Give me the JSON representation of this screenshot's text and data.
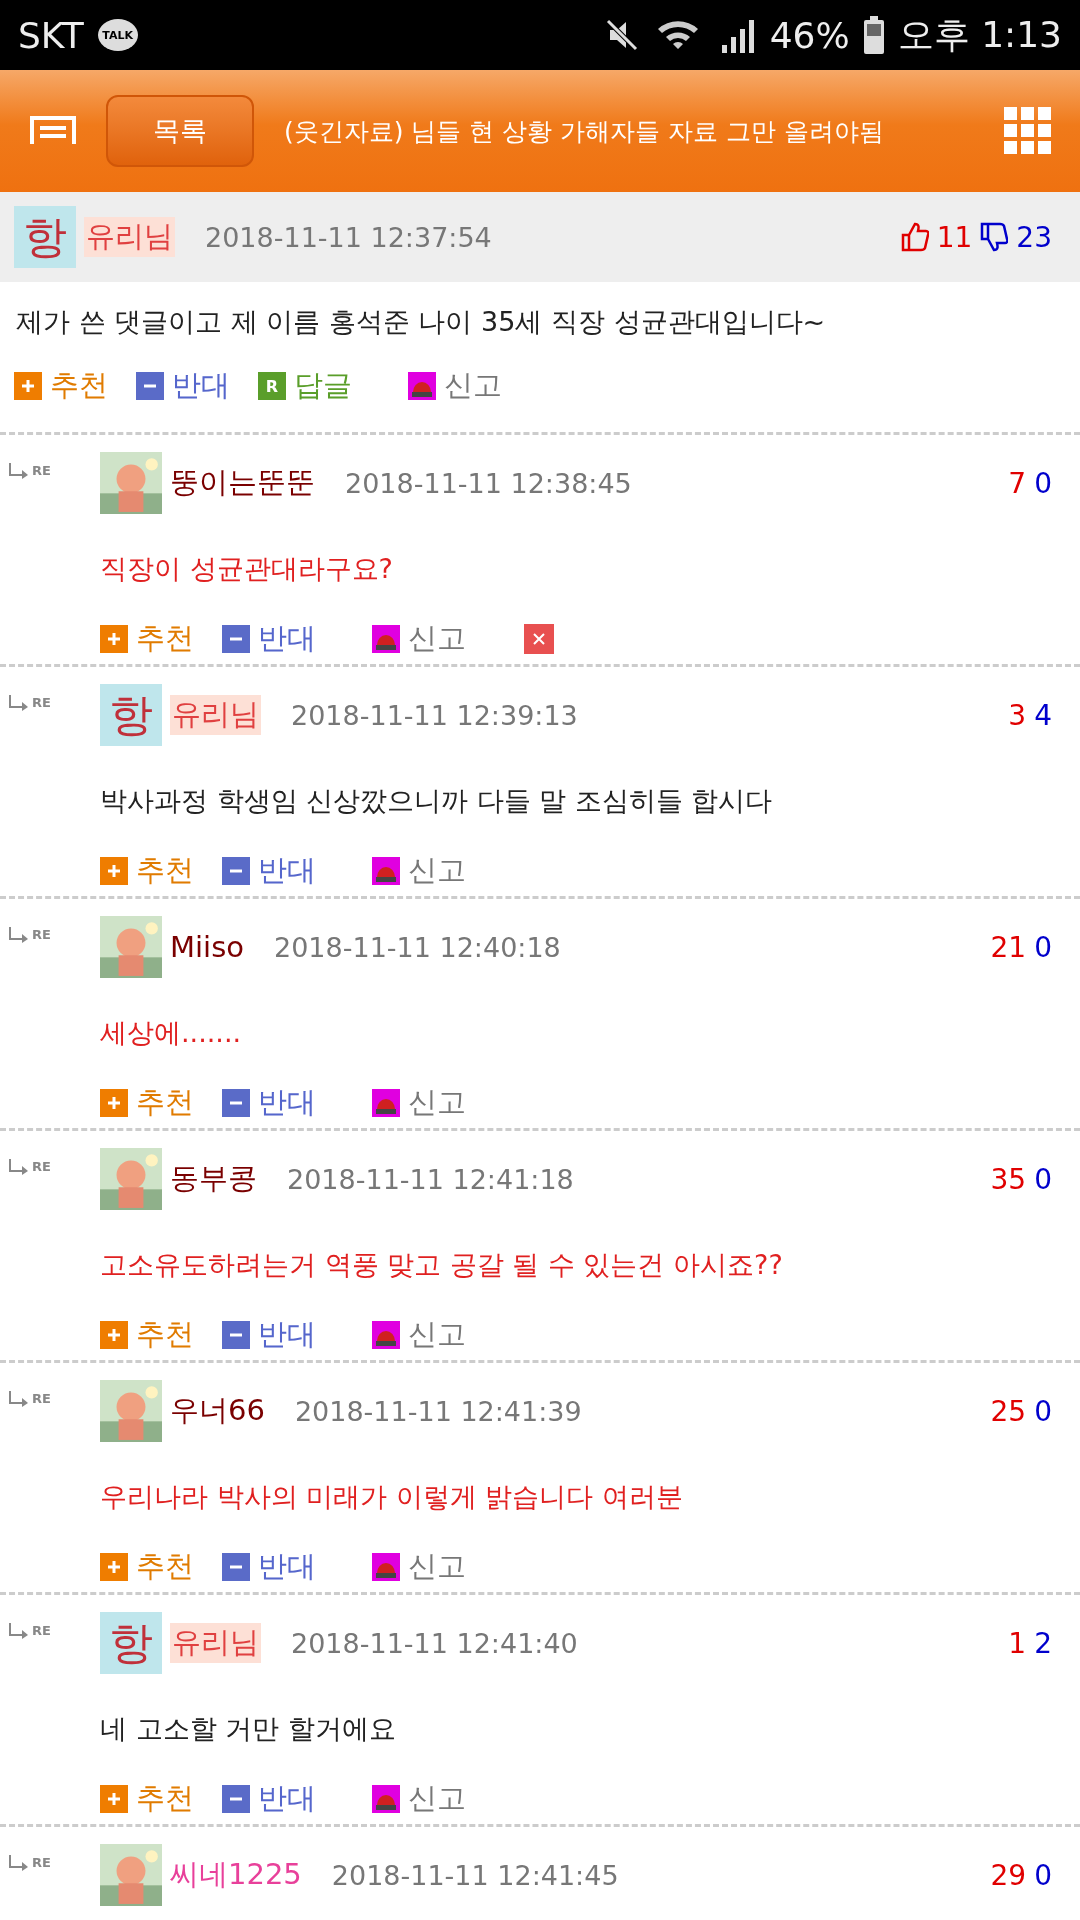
{
  "status_bar": {
    "carrier": "SKT",
    "talk_badge": "TALK",
    "battery": "46%",
    "time": "오후 1:13"
  },
  "header": {
    "list_button": "목록",
    "title": "(웃긴자료) 님들 현 상황 가해자들 자료 그만 올려야됨"
  },
  "post": {
    "avatar": {
      "kind": "text",
      "text": "항"
    },
    "author": "유리님",
    "date": "2018-11-11 12:37:54",
    "likes": "11",
    "dislikes": "23",
    "body": "제가 쓴 댓글이고 제 이름 홍석준 나이 35세 직장 성균관대입니다~",
    "actions": [
      {
        "kind": "recommend",
        "label": "추천"
      },
      {
        "kind": "oppose",
        "label": "반대"
      },
      {
        "kind": "reply",
        "badge": "R",
        "label": "답글"
      },
      {
        "kind": "report",
        "label": "신고"
      }
    ]
  },
  "comments": [
    {
      "reply_mark": "RE",
      "avatar": {
        "kind": "picture"
      },
      "name": "뚱이는뚠뚠",
      "color": "#7a0000",
      "author": false,
      "date": "2018-11-11 12:38:45",
      "up": "7",
      "down": "0",
      "body": "직장이 성균관대라구요?",
      "deletable": true,
      "actions": [
        {
          "kind": "recommend",
          "label": "추천"
        },
        {
          "kind": "oppose",
          "label": "반대"
        },
        {
          "kind": "report",
          "label": "신고"
        }
      ]
    },
    {
      "reply_mark": "RE",
      "avatar": {
        "kind": "text",
        "text": "항"
      },
      "name": "유리님",
      "color": "#e04040",
      "author": true,
      "date": "2018-11-11 12:39:13",
      "up": "3",
      "down": "4",
      "body": "박사과정 학생임 신상깠으니까 다들 말 조심히들 합시다",
      "deletable": false,
      "actions": [
        {
          "kind": "recommend",
          "label": "추천"
        },
        {
          "kind": "oppose",
          "label": "반대"
        },
        {
          "kind": "report",
          "label": "신고"
        }
      ]
    },
    {
      "reply_mark": "RE",
      "avatar": {
        "kind": "picture"
      },
      "name": "Miiso",
      "color": "#7a0000",
      "author": false,
      "date": "2018-11-11 12:40:18",
      "up": "21",
      "down": "0",
      "body": "세상에.......",
      "deletable": false,
      "actions": [
        {
          "kind": "recommend",
          "label": "추천"
        },
        {
          "kind": "oppose",
          "label": "반대"
        },
        {
          "kind": "report",
          "label": "신고"
        }
      ]
    },
    {
      "reply_mark": "RE",
      "avatar": {
        "kind": "picture"
      },
      "name": "동부콩",
      "color": "#7a0000",
      "author": false,
      "date": "2018-11-11 12:41:18",
      "up": "35",
      "down": "0",
      "body": "고소유도하려는거 역풍 맞고 공갈 될 수 있는건 아시죠??",
      "deletable": false,
      "actions": [
        {
          "kind": "recommend",
          "label": "추천"
        },
        {
          "kind": "oppose",
          "label": "반대"
        },
        {
          "kind": "report",
          "label": "신고"
        }
      ]
    },
    {
      "reply_mark": "RE",
      "avatar": {
        "kind": "picture"
      },
      "name": "우너66",
      "color": "#7a0000",
      "author": false,
      "date": "2018-11-11 12:41:39",
      "up": "25",
      "down": "0",
      "body": "우리나라 박사의 미래가 이렇게 밝습니다 여러분",
      "deletable": false,
      "actions": [
        {
          "kind": "recommend",
          "label": "추천"
        },
        {
          "kind": "oppose",
          "label": "반대"
        },
        {
          "kind": "report",
          "label": "신고"
        }
      ]
    },
    {
      "reply_mark": "RE",
      "avatar": {
        "kind": "text",
        "text": "항"
      },
      "name": "유리님",
      "color": "#e04040",
      "author": true,
      "date": "2018-11-11 12:41:40",
      "up": "1",
      "down": "2",
      "body": "네 고소할 거만 할거에요",
      "deletable": false,
      "actions": [
        {
          "kind": "recommend",
          "label": "추천"
        },
        {
          "kind": "oppose",
          "label": "반대"
        },
        {
          "kind": "report",
          "label": "신고"
        }
      ]
    },
    {
      "reply_mark": "RE",
      "avatar": {
        "kind": "picture"
      },
      "name": "씨네1225",
      "color": "#e8409a",
      "author": false,
      "date": "2018-11-11 12:41:45",
      "up": "29",
      "down": "0"
    }
  ]
}
